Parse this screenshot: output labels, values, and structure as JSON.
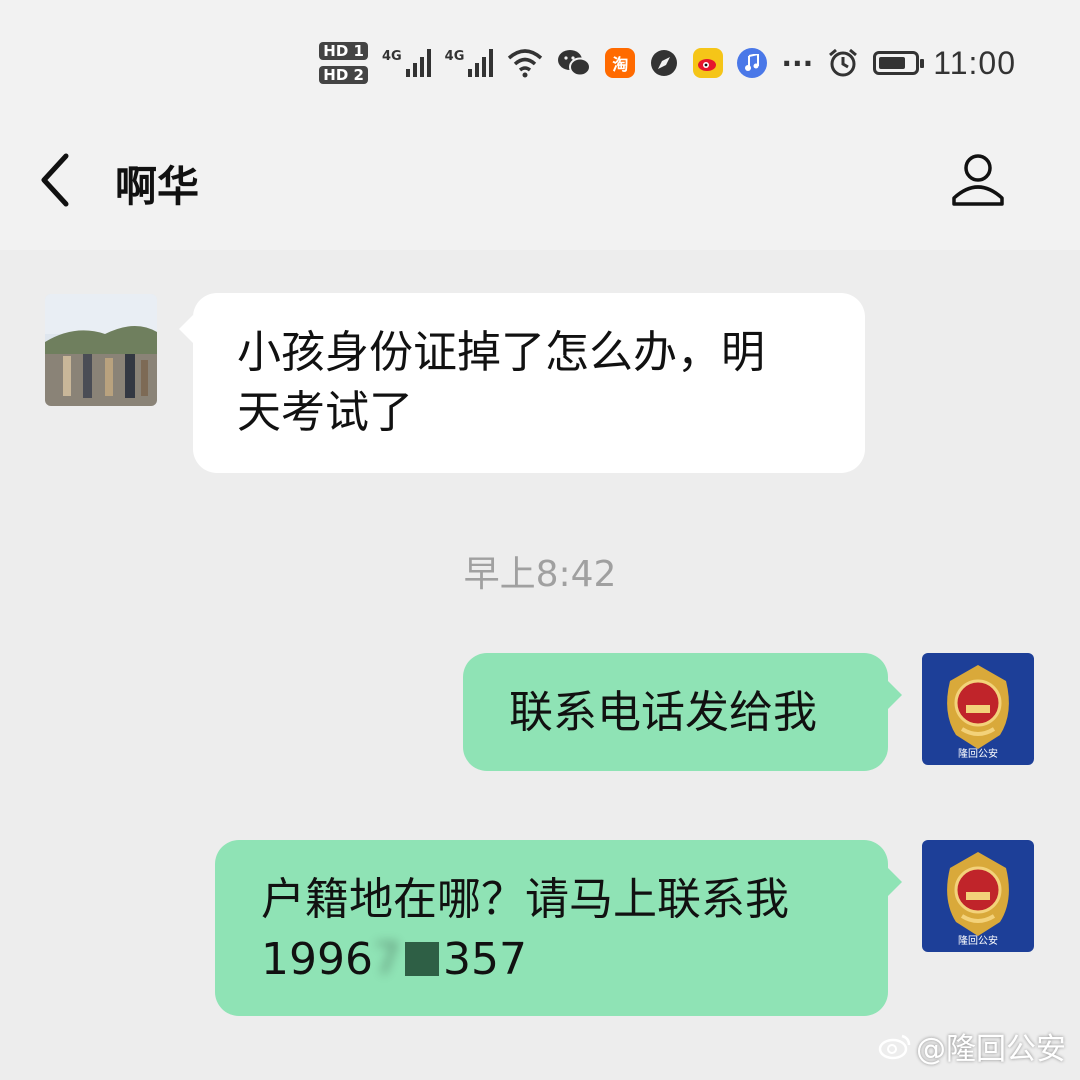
{
  "status_bar": {
    "sim1": "HD 1",
    "sim2": "HD 2",
    "net1": "4G",
    "net2": "4G",
    "taobao_label": "淘",
    "more": "···",
    "time": "11:00",
    "battery_level": 0.75,
    "icons": [
      "hd-sim-icon",
      "signal-icon",
      "wifi-icon",
      "wechat-icon",
      "taobao-icon",
      "compass-icon",
      "weibo-icon",
      "music-icon",
      "alarm-icon",
      "battery-icon"
    ]
  },
  "nav": {
    "title": "啊华",
    "back_icon": "chevron-left-icon",
    "profile_icon": "person-icon"
  },
  "messages": [
    {
      "direction": "in",
      "text_line1": "小孩身份证掉了怎么办，明",
      "text_line2": "天考试了"
    },
    {
      "direction": "out",
      "text": "联系电话发给我"
    },
    {
      "direction": "out",
      "text_line1": "户籍地在哪？请马上联系我",
      "phone_start": "1996",
      "phone_hidden": "7",
      "phone_end": "357"
    }
  ],
  "timestamp": "早上8:42",
  "police_badge_text": "隆回公安",
  "watermark": "@隆回公安",
  "colors": {
    "outgoing_bubble": "#8fe3b5",
    "incoming_bubble": "#ffffff",
    "background": "#ededed"
  }
}
